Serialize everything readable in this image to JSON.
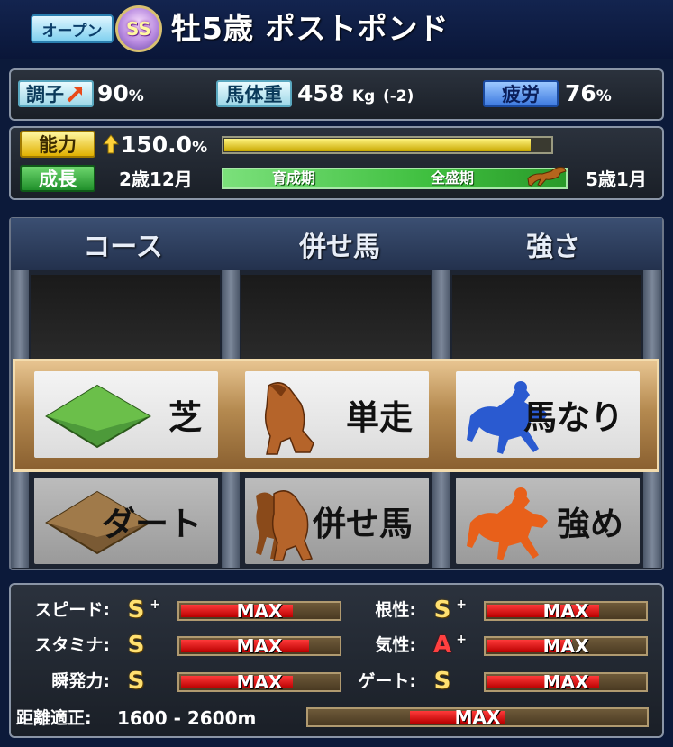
{
  "header": {
    "class_label": "オープン",
    "rank": "SS",
    "horse_title": "牡5歳 ポストポンド"
  },
  "condition": {
    "condition_label": "調子",
    "condition_value": "90",
    "condition_unit": "%",
    "weight_label": "馬体重",
    "weight_value": "458",
    "weight_unit": "Kg",
    "weight_diff": "(-2)",
    "fatigue_label": "疲労",
    "fatigue_value": "76",
    "fatigue_unit": "%"
  },
  "ability": {
    "ability_label": "能力",
    "ability_value": "150.0",
    "ability_unit": "%",
    "ability_fill": 0.94,
    "growth_label": "成長",
    "growth_start": "2歳12月",
    "growth_end": "5歳1月",
    "phase_1": "育成期",
    "phase_2": "全盛期"
  },
  "training": {
    "headers": [
      "コース",
      "併せ馬",
      "強さ"
    ],
    "row1": [
      "芝",
      "単走",
      "馬なり"
    ],
    "row2": [
      "ダート",
      "併せ馬",
      "強め"
    ]
  },
  "stats": {
    "speed_label": "スピード:",
    "speed_grade": "S",
    "speed_plus": "+",
    "stamina_label": "スタミナ:",
    "stamina_grade": "S",
    "burst_label": "瞬発力:",
    "burst_grade": "S",
    "guts_label": "根性:",
    "guts_grade": "S",
    "guts_plus": "+",
    "temper_label": "気性:",
    "temper_grade": "A",
    "temper_plus": "+",
    "gate_label": "ゲート:",
    "gate_grade": "S",
    "max_text": "MAX",
    "distance_label": "距離適正:",
    "distance_value": "1600 - 2600m",
    "speed_fill": 0.72,
    "stamina_fill": 0.82,
    "burst_fill": 0.72,
    "guts_fill": 0.72,
    "temper_fill": 0.55,
    "gate_fill": 0.72
  },
  "colors": {
    "accent_gold": "#e0b000",
    "max_red": "#e00000",
    "growth_green": "#3fbf3f"
  }
}
